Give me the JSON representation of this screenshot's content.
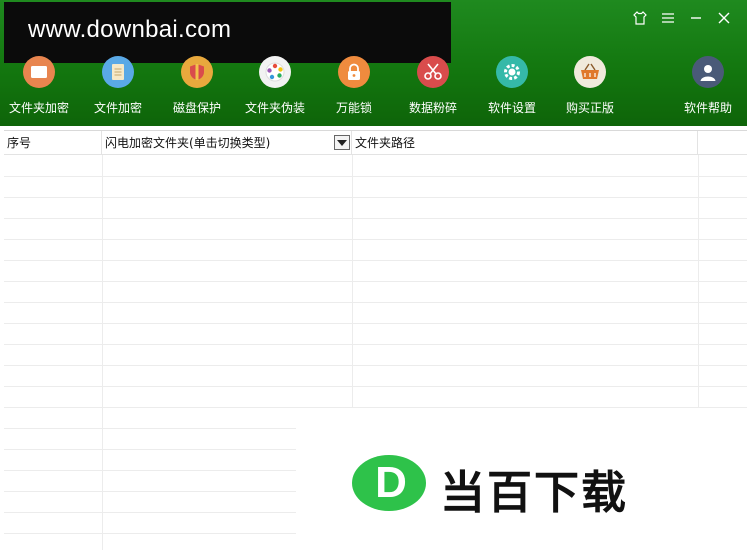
{
  "watermark": {
    "text": "www.downbai.com"
  },
  "window_controls": {
    "skin": "\u0000",
    "menu": "≡",
    "minimize": "—",
    "close": "✕"
  },
  "toolbar": {
    "items": [
      {
        "label": "文件夹加密",
        "icon": "folder-icon",
        "color": "#e8854f"
      },
      {
        "label": "文件加密",
        "icon": "document-icon",
        "color": "#5aa9e6"
      },
      {
        "label": "磁盘保护",
        "icon": "shield-icon",
        "color": "#e8a93d"
      },
      {
        "label": "文件夹伪装",
        "icon": "palette-icon",
        "color": "#f2f2f2"
      },
      {
        "label": "万能锁",
        "icon": "lock-icon",
        "color": "#ef8b3e"
      },
      {
        "label": "数据粉碎",
        "icon": "scissors-icon",
        "color": "#d94c4c"
      },
      {
        "label": "软件设置",
        "icon": "gear-icon",
        "color": "#35b9a8"
      },
      {
        "label": "购买正版",
        "icon": "basket-icon",
        "color": "#f0eadc"
      },
      {
        "label": "软件帮助",
        "icon": "user-icon",
        "color": "#4a5a78"
      }
    ]
  },
  "table": {
    "columns": [
      "序号",
      "闪电加密文件夹(单击切换类型)",
      "文件夹路径",
      ""
    ],
    "rows": []
  },
  "logo": {
    "badge": "D",
    "text": "当百下载",
    "badge_color": "#2ec24a"
  }
}
